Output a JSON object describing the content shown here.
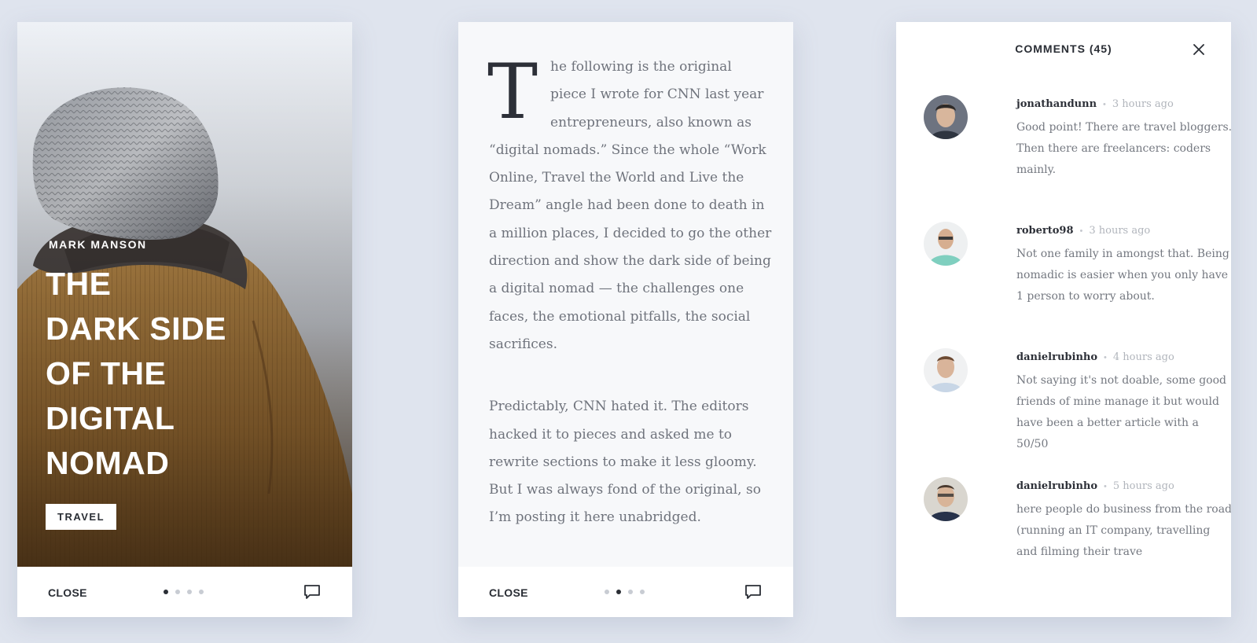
{
  "cover": {
    "author": "MARK MANSON",
    "title_lines": [
      "THE",
      "DARK SIDE",
      "OF THE",
      "DIGITAL",
      "NOMAD"
    ],
    "tag": "TRAVEL",
    "close_label": "CLOSE",
    "active_page": 1,
    "page_count": 4
  },
  "article": {
    "dropcap": "T",
    "paragraph1": "he following is the original piece I wrote for CNN last year entrepreneurs, also known as “digital nomads.” Since the whole “Work Online, Travel the World and Live the Dream” angle had been done to death in a million places, I decided to go the other direction and show the dark side of being a digital nomad — the challenges one faces, the emotional pitfalls, the social sacrifices.",
    "paragraph2": "Predictably, CNN hated it. The editors hacked it to pieces and asked me to rewrite sections to make it less gloomy. But I was always fond of the original, so I’m posting it here unabridged.",
    "close_label": "CLOSE",
    "active_page": 2,
    "page_count": 4
  },
  "comments": {
    "header": "COMMENTS (45)",
    "items": [
      {
        "user": "jonathandunn",
        "time": "3 hours ago",
        "text": "Good point! There are travel bloggers. Then there are freelancers: coders mainly."
      },
      {
        "user": "roberto98",
        "time": "3 hours ago",
        "text": "Not one family in amongst that. Being nomadic is easier when you only have 1 person to worry about."
      },
      {
        "user": "danielrubinho",
        "time": "4 hours ago",
        "text": "Not saying it's not doable, some good friends of mine manage it but would have been a better article with a 50/50"
      },
      {
        "user": "danielrubinho",
        "time": "5 hours ago",
        "text": "here people do business from the road (running an IT company, travelling and filming their trave"
      }
    ]
  },
  "colors": {
    "background": "#dfe4ee",
    "text_dark": "#2a2e35",
    "text_body": "#6f737c",
    "dot_inactive": "#c8ccd3"
  },
  "icons": {
    "comment": "speech-bubble-icon",
    "close": "close-x-icon"
  }
}
